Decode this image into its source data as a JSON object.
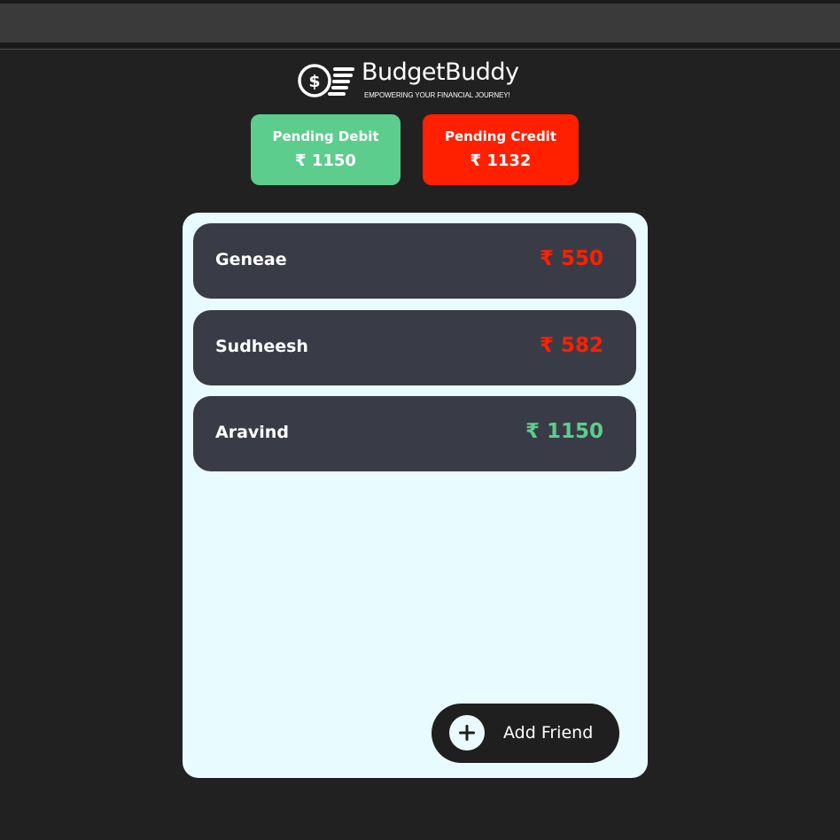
{
  "app": {
    "name": "BudgetBuddy",
    "tagline": "EMPOWERING YOUR FINANCIAL JOURNEY!"
  },
  "summary": {
    "debit": {
      "label": "Pending Debit",
      "amount": "₹ 1150",
      "color": "#5ccd8d"
    },
    "credit": {
      "label": "Pending Credit",
      "amount": "₹ 1132",
      "color": "#ff2000"
    }
  },
  "friends": [
    {
      "name": "Geneae",
      "amount": "₹ 550",
      "color": "#ff2000"
    },
    {
      "name": "Sudheesh",
      "amount": "₹ 582",
      "color": "#ff2000"
    },
    {
      "name": "Aravind",
      "amount": "₹ 1150",
      "color": "#5ccd8d"
    }
  ],
  "actions": {
    "add_friend_label": "Add Friend",
    "add_icon": "plus-icon"
  },
  "colors": {
    "background": "#212121",
    "panel": "#e8fbff",
    "row": "#393c46",
    "debit_green": "#5ccd8d",
    "credit_red": "#ff2000"
  }
}
